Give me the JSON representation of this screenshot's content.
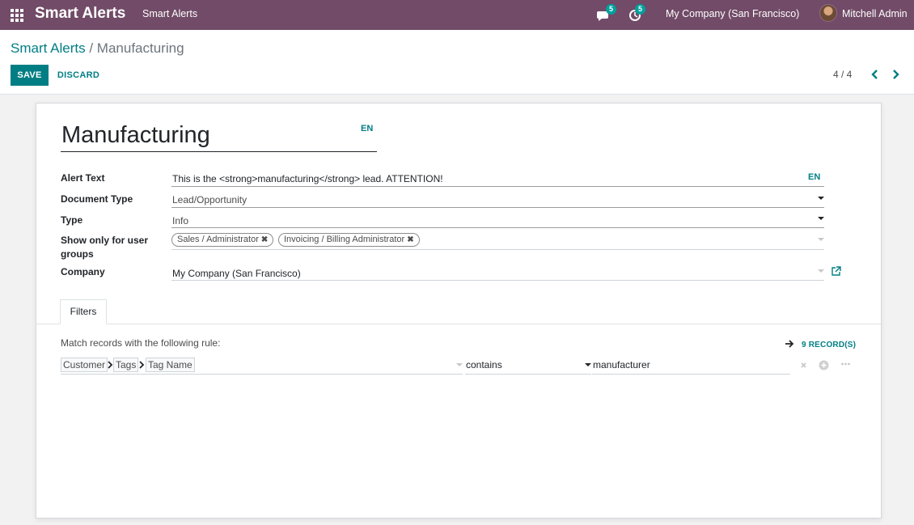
{
  "navbar": {
    "brand": "Smart Alerts",
    "menu": "Smart Alerts",
    "messages_count": "5",
    "activities_count": "5",
    "company": "My Company (San Francisco)",
    "user": "Mitchell Admin"
  },
  "control_panel": {
    "breadcrumb_root": "Smart Alerts",
    "breadcrumb_sep": "/",
    "breadcrumb_current": "Manufacturing",
    "save_label": "SAVE",
    "discard_label": "DISCARD",
    "pager": "4 / 4"
  },
  "form": {
    "name": "Manufacturing",
    "name_lang": "EN",
    "fields": {
      "alert_text_label": "Alert Text",
      "alert_text_value": "This is the <strong>manufacturing</strong> lead. ATTENTION!",
      "alert_text_lang": "EN",
      "document_type_label": "Document Type",
      "document_type_value": "Lead/Opportunity",
      "type_label": "Type",
      "type_value": "Info",
      "groups_label": "Show only for user groups",
      "groups": [
        "Sales / Administrator",
        "Invoicing / Billing Administrator"
      ],
      "company_label": "Company",
      "company_value": "My Company (San Francisco)"
    },
    "notebook": {
      "tab": "Filters",
      "rule_label": "Match records with the following rule:",
      "records_link": "9 RECORD(S)",
      "path": [
        "Customer",
        "Tags",
        "Tag Name"
      ],
      "operator": "contains",
      "value": "manufacturer"
    }
  },
  "colors": {
    "navbar": "#714b67",
    "primary": "#017e84",
    "badge": "#00a09d"
  },
  "icons": [
    "apps-icon",
    "chat-icon",
    "clock-icon",
    "chevron-left-icon",
    "chevron-right-icon",
    "external-link-icon",
    "arrow-right-icon",
    "close-icon",
    "add-icon",
    "ellipsis-icon"
  ]
}
